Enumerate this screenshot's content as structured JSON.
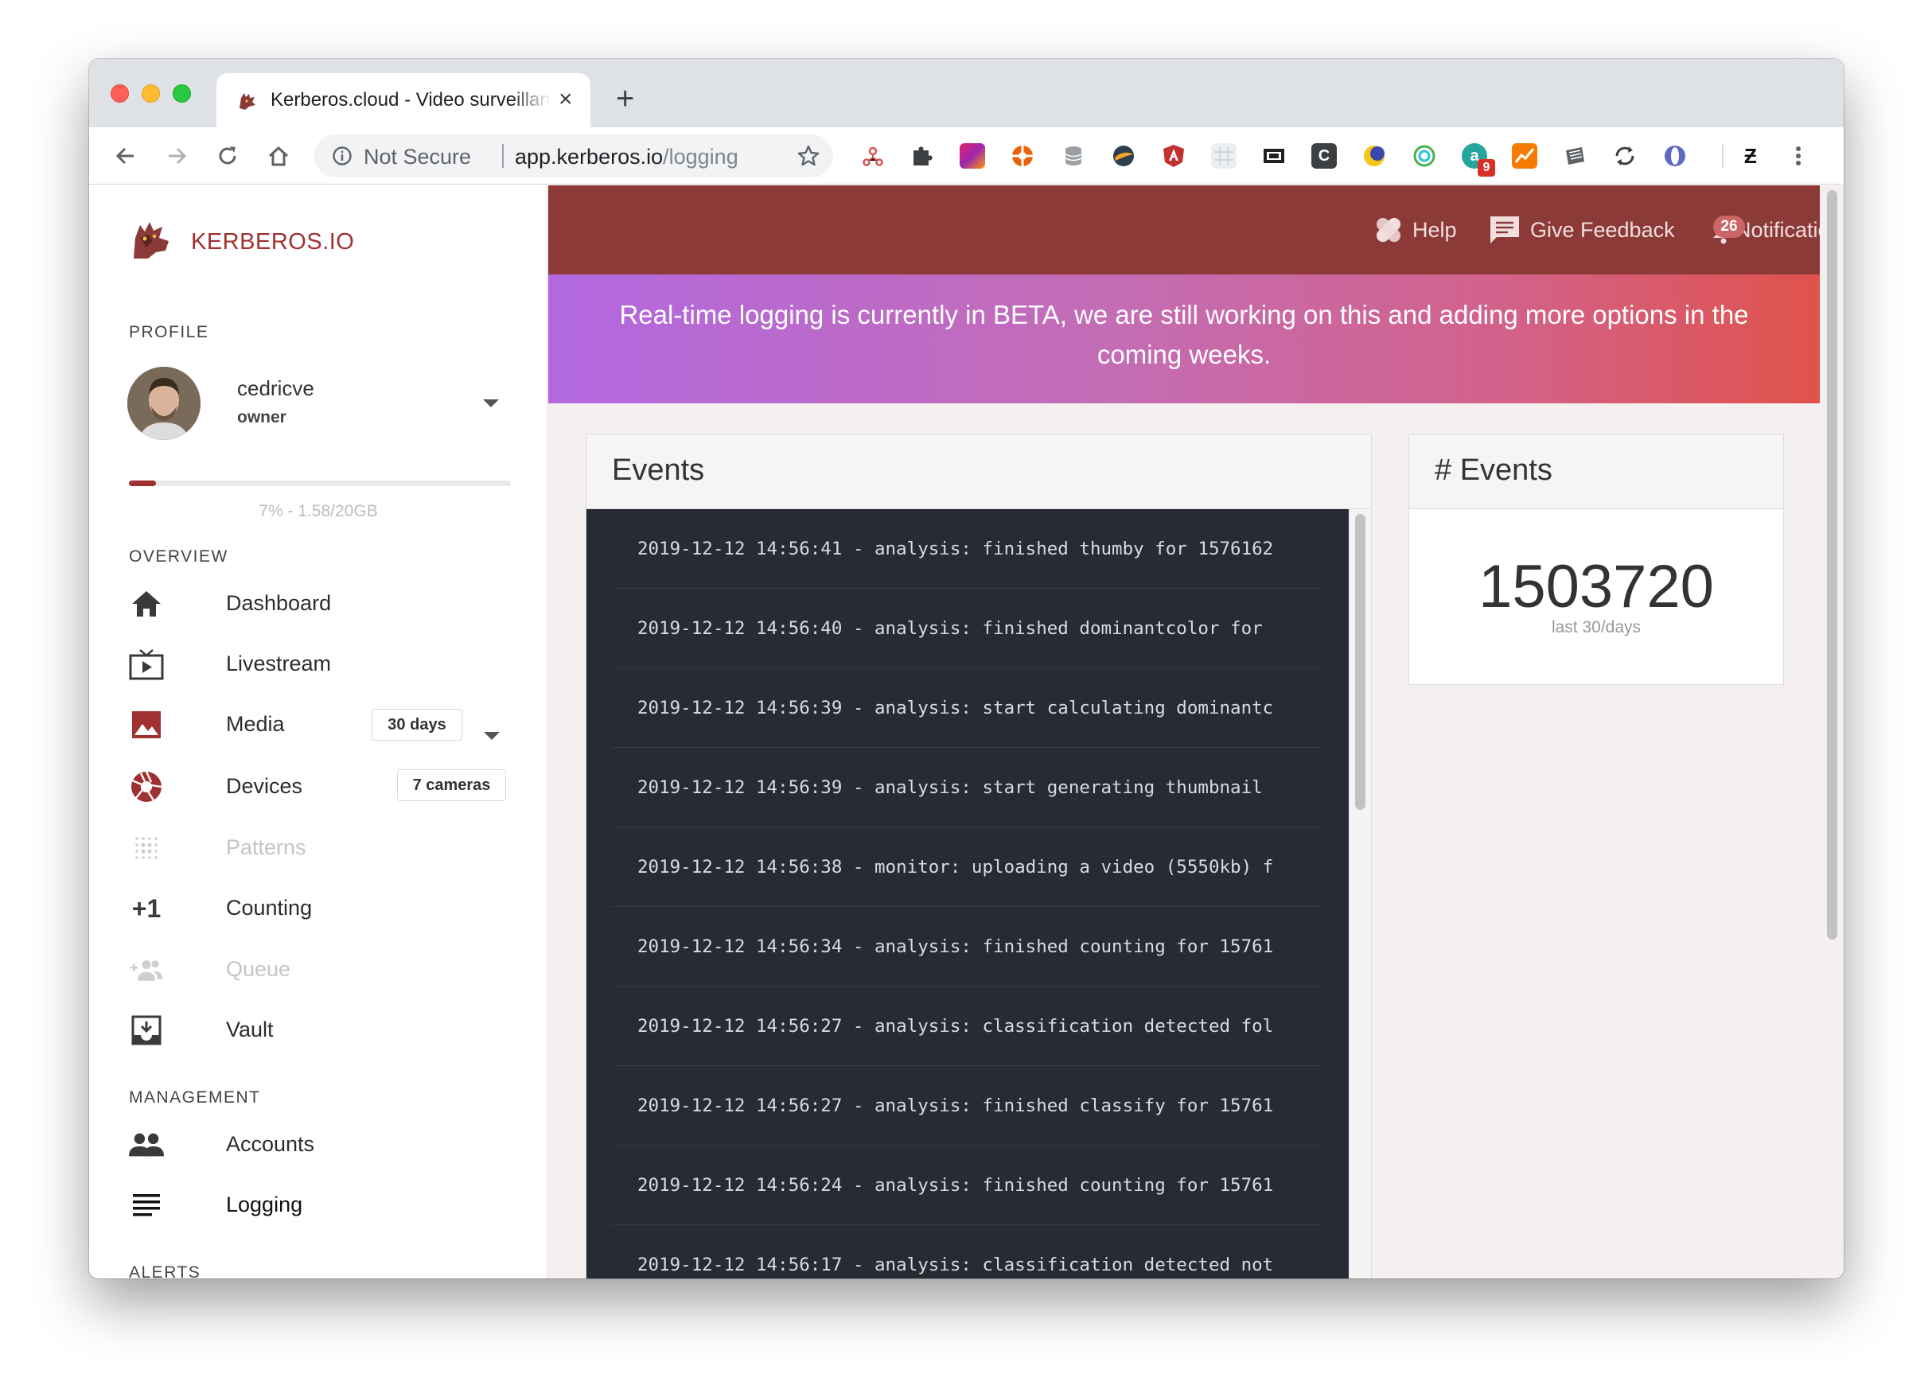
{
  "browser": {
    "tab_title": "Kerberos.cloud - Video surveillance",
    "tab_close": "×",
    "new_tab": "+",
    "address_security": "Not Secure",
    "address_host": "app.kerberos.io",
    "address_path": "/logging",
    "extension_icons": [
      "network-ext",
      "puzzle-ext",
      "gradient-ext",
      "lifebuoy-ext",
      "database-ext",
      "stormy-ext",
      "angular-ext",
      "grid-ext",
      "screenshot-ext",
      "c-ext",
      "moon-ext",
      "target-ext",
      "a-ext",
      "chart-ext",
      "paper-ext",
      "sync-ext",
      "orb-ext",
      "z-ext"
    ],
    "ext_badge": "9",
    "c_ext_label": "C",
    "a_ext_label": "a",
    "z_ext_label": "Ƶ",
    "menu_icon": "more-vertical"
  },
  "sidebar": {
    "brand": "KERBEROS.IO",
    "profile_heading": "PROFILE",
    "username": "cedricve",
    "role": "owner",
    "usage_fraction": 0.07,
    "usage_label": "7% - 1.58/20GB",
    "overview_heading": "OVERVIEW",
    "overview": [
      {
        "label": "Dashboard",
        "icon": "home-icon",
        "state": "normal"
      },
      {
        "label": "Livestream",
        "icon": "tv-icon",
        "state": "normal"
      },
      {
        "label": "Media",
        "icon": "image-icon",
        "state": "normal",
        "badge": "30 days"
      },
      {
        "label": "Devices",
        "icon": "camera-shutter-icon",
        "state": "normal",
        "badge": "7 cameras"
      },
      {
        "label": "Patterns",
        "icon": "dots-grid-icon",
        "state": "disabled"
      },
      {
        "label": "Counting",
        "icon": "plus-one-icon",
        "state": "normal",
        "glyph": "+1"
      },
      {
        "label": "Queue",
        "icon": "group-add-icon",
        "state": "disabled"
      },
      {
        "label": "Vault",
        "icon": "archive-icon",
        "state": "normal"
      }
    ],
    "management_heading": "MANAGEMENT",
    "management": [
      {
        "label": "Accounts",
        "icon": "people-icon",
        "state": "normal"
      },
      {
        "label": "Logging",
        "icon": "list-icon",
        "state": "active"
      }
    ],
    "alerts_heading": "ALERTS"
  },
  "topbar": {
    "help": "Help",
    "feedback": "Give Feedback",
    "notifications": "Notifications",
    "notification_count": "26"
  },
  "banner": "Real-time logging is currently in BETA, we are still working on this and adding more options in the coming weeks.",
  "events_panel": {
    "title": "Events",
    "logs": [
      "2019-12-12 14:56:41 - analysis:  finished thumby for 1576162",
      "2019-12-12 14:56:40 - analysis:  finished dominantcolor for",
      "2019-12-12 14:56:39 - analysis:  start calculating dominantc",
      "2019-12-12 14:56:39 - analysis:  start generating thumbnail",
      "2019-12-12 14:56:38 - monitor:  uploading a video (5550kb) f",
      "2019-12-12 14:56:34 - analysis:  finished counting for 15761",
      "2019-12-12 14:56:27 - analysis:  classification detected fol",
      "2019-12-12 14:56:27 - analysis:  finished classify for 15761",
      "2019-12-12 14:56:24 - analysis:  finished counting for 15761",
      "2019-12-12 14:56:17 - analysis:  classification detected not"
    ]
  },
  "count_panel": {
    "title": "# Events",
    "value": "1503720",
    "caption": "last 30/days"
  },
  "colors": {
    "brand": "#a13030",
    "topbar": "#8b3a38",
    "log_bg": "#272b33"
  }
}
